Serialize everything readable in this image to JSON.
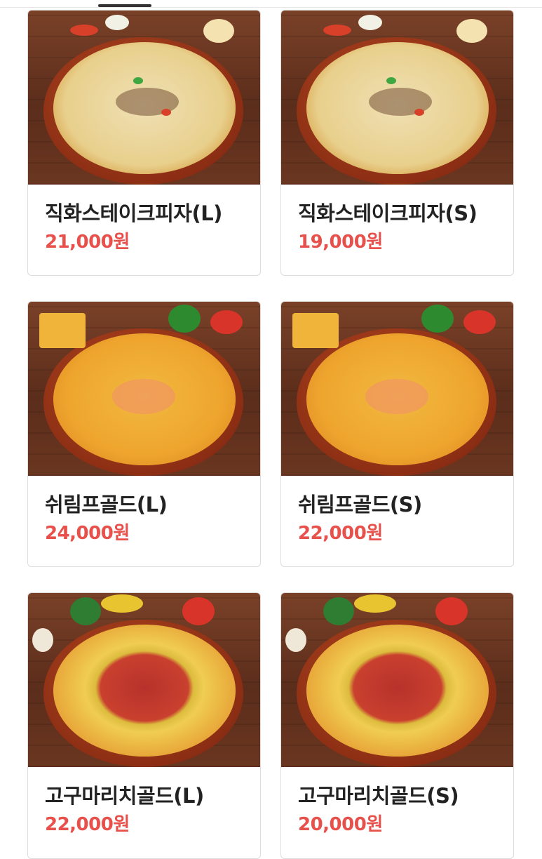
{
  "products": [
    {
      "name": "직화스테이크피자(L)",
      "price": "21,000원",
      "image": "steak-pizza-image"
    },
    {
      "name": "직화스테이크피자(S)",
      "price": "19,000원",
      "image": "steak-pizza-image"
    },
    {
      "name": "쉬림프골드(L)",
      "price": "24,000원",
      "image": "shrimp-gold-pizza-image"
    },
    {
      "name": "쉬림프골드(S)",
      "price": "22,000원",
      "image": "shrimp-gold-pizza-image"
    },
    {
      "name": "고구마리치골드(L)",
      "price": "22,000원",
      "image": "sweet-potato-gold-pizza-image"
    },
    {
      "name": "고구마리치골드(S)",
      "price": "20,000원",
      "image": "sweet-potato-gold-pizza-image"
    }
  ],
  "colors": {
    "price": "#e8504b",
    "name": "#222222",
    "card_border": "#dcdcdc"
  }
}
